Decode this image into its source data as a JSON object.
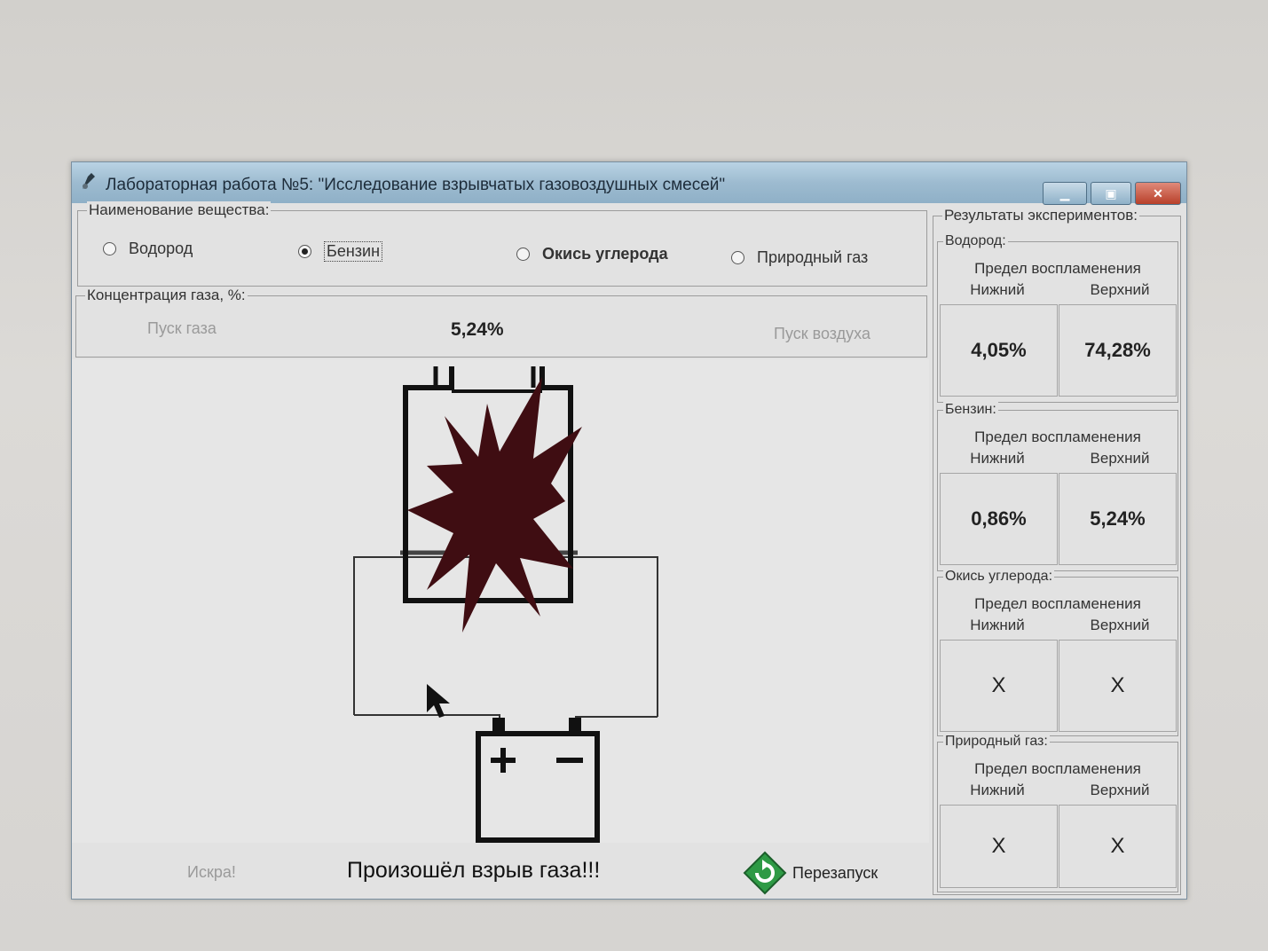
{
  "window": {
    "title": "Лабораторная работа №5: \"Исследование взрывчатых газовоздушных смесей\"",
    "minimize": "▁",
    "maximize": "▣",
    "close": "✕"
  },
  "substance": {
    "legend": "Наименование вещества:",
    "options": [
      "Водород",
      "Бензин",
      "Окись углерода",
      "Природный газ"
    ],
    "selected": "Бензин"
  },
  "concentration": {
    "legend": "Концентрация газа, %:",
    "gas_button": "Пуск газа",
    "value": "5,24%",
    "air_button": "Пуск воздуха"
  },
  "bottom": {
    "spark_button": "Искра!",
    "status": "Произошёл взрыв газа!!!",
    "restart_button": "Перезапуск"
  },
  "results": {
    "legend": "Результаты экспериментов:",
    "groups": [
      {
        "name": "Водород:",
        "limit_title": "Предел воспламенения",
        "lower_label": "Нижний",
        "upper_label": "Верхний",
        "lower": "4,05%",
        "upper": "74,28%"
      },
      {
        "name": "Бензин:",
        "limit_title": "Предел воспламенения",
        "lower_label": "Нижний",
        "upper_label": "Верхний",
        "lower": "0,86%",
        "upper": "5,24%"
      },
      {
        "name": "Окись углерода:",
        "limit_title": "Предел воспламенения",
        "lower_label": "Нижний",
        "upper_label": "Верхний",
        "lower": "X",
        "upper": "X"
      },
      {
        "name": "Природный газ:",
        "limit_title": "Предел воспламенения",
        "lower_label": "Нижний",
        "upper_label": "Верхний",
        "lower": "X",
        "upper": "X"
      }
    ]
  },
  "colors": {
    "explosion": "#3f0d12",
    "titlebar": "#9dbbd0",
    "restart_icon": "#2e9a45"
  },
  "icons": {
    "app": "flask-icon",
    "restart": "restart-icon",
    "cursor": "cursor-icon"
  }
}
